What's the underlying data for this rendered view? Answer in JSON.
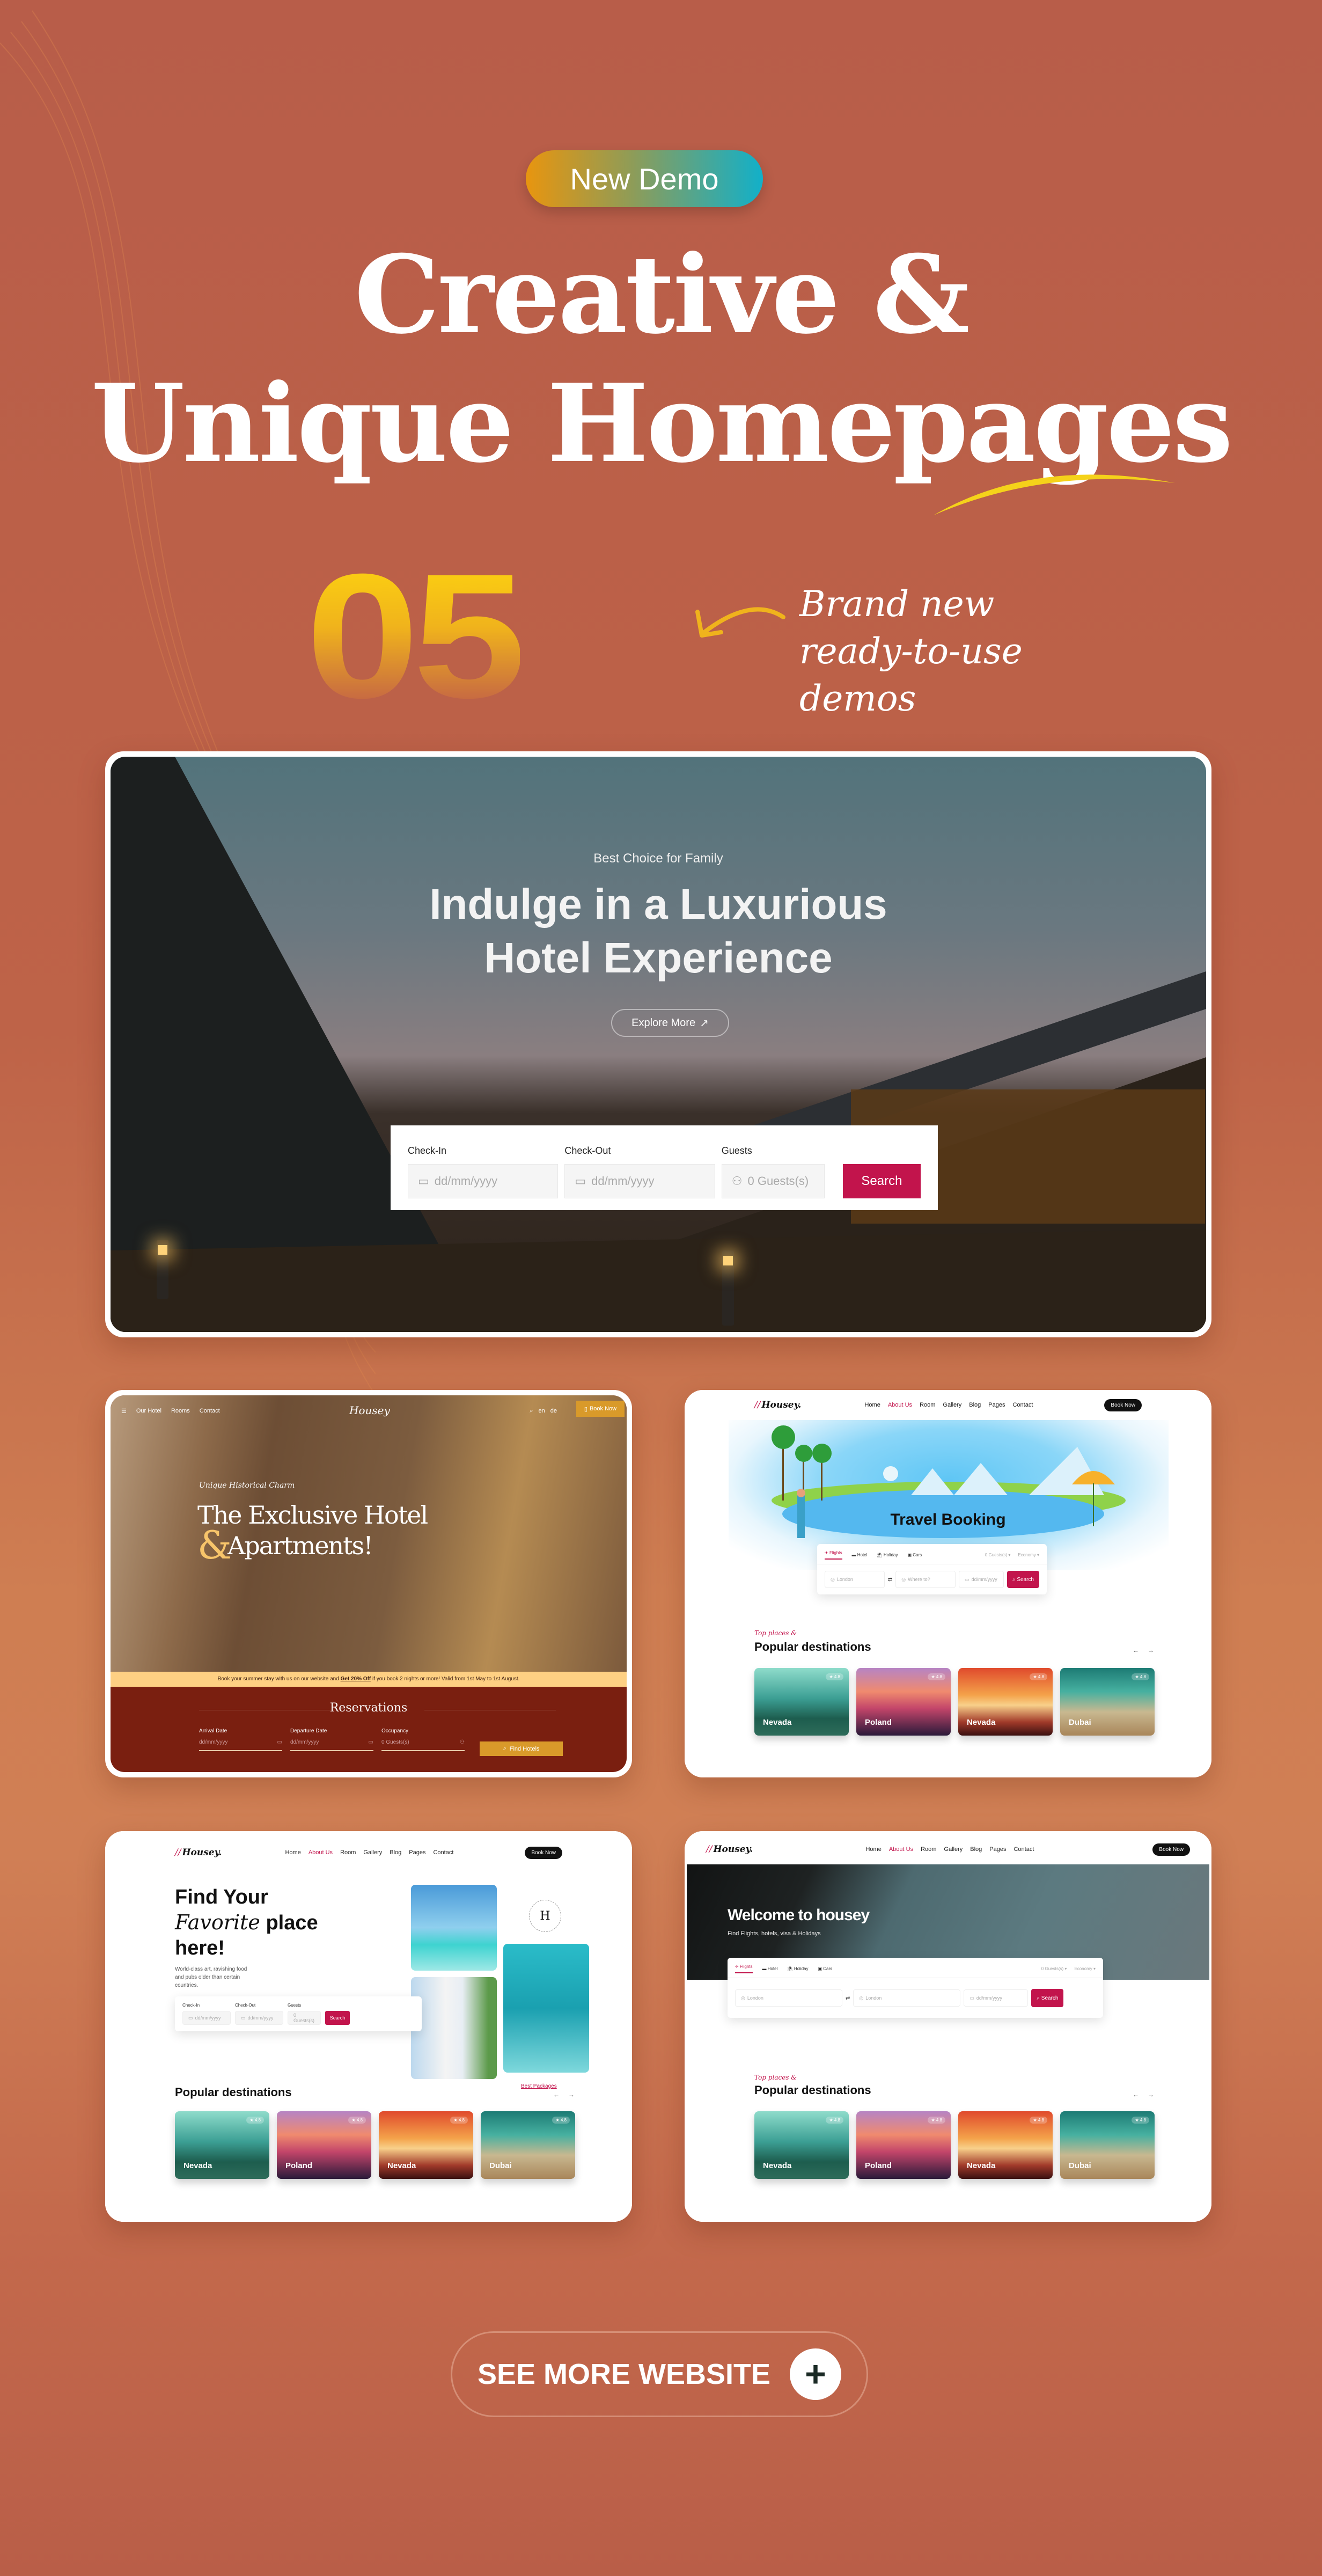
{
  "badge": {
    "label": "New Demo",
    "gradient": [
      "#e8950f",
      "#12b0c9"
    ]
  },
  "headline": {
    "line1": "Creative &",
    "line2": "Unique Homepages"
  },
  "count": {
    "number": "05",
    "caption_lines": [
      "Brand new",
      "ready-to-use",
      "demos"
    ]
  },
  "theme": {
    "accent": "#c2144c",
    "gold": "#d99a2a",
    "background": "#be6348"
  },
  "demo1": {
    "eyebrow": "Best Choice for Family",
    "title_line1": "Indulge in a Luxurious",
    "title_line2": "Hotel Experience",
    "explore_label": "Explore More",
    "booking": {
      "checkin_label": "Check-In",
      "checkin_placeholder": "dd/mm/yyyy",
      "checkout_label": "Check-Out",
      "checkout_placeholder": "dd/mm/yyyy",
      "guests_label": "Guests",
      "guests_placeholder": "0 Guests(s)",
      "search_label": "Search"
    }
  },
  "demo2": {
    "nav": [
      "Our Hotel",
      "Rooms",
      "Contact"
    ],
    "logo": "Housey",
    "lang": [
      "en",
      "de"
    ],
    "book_now": "Book Now",
    "kicker": "Unique Historical Charm",
    "title_line1": "The Exclusive Hotel",
    "title_amp": "&",
    "title_line2": "Apartments!",
    "promo_pre": "Book your summer stay with us on our website and",
    "promo_bold": "Get 20% Off",
    "promo_post": "if you book 2 nights or more! Valid from 1st May to 1st August.",
    "reservations": "Reservations",
    "fields": [
      {
        "label": "Arrival Date",
        "placeholder": "dd/mm/yyyy"
      },
      {
        "label": "Departure Date",
        "placeholder": "dd/mm/yyyy"
      },
      {
        "label": "Occupancy",
        "placeholder": "0 Guests(s)"
      }
    ],
    "find_label": "Find Hotels"
  },
  "site_nav": {
    "logo": "Housey.",
    "links": [
      "Home",
      "About Us",
      "Room",
      "Gallery",
      "Blog",
      "Pages",
      "Contact"
    ],
    "active": "About Us",
    "book_now": "Book Now"
  },
  "demo3": {
    "title": "Travel Booking",
    "tabs": [
      "Flights",
      "Hotel",
      "Holiday",
      "Cars"
    ],
    "guests": "0 Guests(s)",
    "cabin": "Economy",
    "from_placeholder": "London",
    "to_placeholder": "Where to?",
    "date_placeholder": "dd/mm/yyyy",
    "search_label": "Search"
  },
  "destinations": {
    "kicker": "Top places &",
    "heading": "Popular destinations",
    "items": [
      {
        "name": "Nevada",
        "rating": "4.8"
      },
      {
        "name": "Poland",
        "rating": "4.8"
      },
      {
        "name": "Nevada",
        "rating": "4.8"
      },
      {
        "name": "Dubai",
        "rating": "4.8"
      }
    ]
  },
  "demo4": {
    "title_line1": "Find Your",
    "title_script": "Favorite",
    "title_line2_rest": "place",
    "title_line3": "here!",
    "desc": "World-class art, ravishing food and pubs older than certain countries.",
    "badge_letter": "H",
    "badge_ring": "HOTEL & RESORT",
    "best_packages": "Best Packages",
    "checkin_label": "Check-In",
    "checkout_label": "Check-Out",
    "guests_label": "Guests",
    "date_placeholder": "dd/mm/yyyy",
    "guests_placeholder": "0 Guests(s)",
    "search_label": "Search"
  },
  "demo5": {
    "title": "Welcome to housey",
    "subtitle": "Find Flights, hotels, visa & Holidays",
    "from_placeholder": "London",
    "to_placeholder": "London"
  },
  "cta": {
    "label": "SEE MORE WEBSITE"
  }
}
